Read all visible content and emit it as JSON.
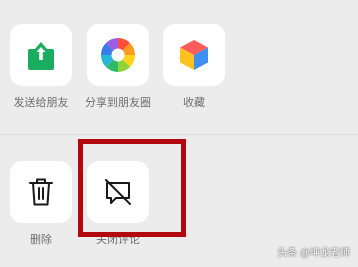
{
  "share_row": [
    {
      "label": "发送给朋友",
      "icon": "send-up-icon"
    },
    {
      "label": "分享到朋友圈",
      "icon": "moments-shutter-icon"
    },
    {
      "label": "收藏",
      "icon": "favorites-cube-icon"
    }
  ],
  "action_row": [
    {
      "label": "删除",
      "icon": "trash-icon"
    },
    {
      "label": "关闭评论",
      "icon": "comment-off-icon"
    }
  ],
  "watermark": "头条 @坤龙老师",
  "colors": {
    "background": "#ececec",
    "tile": "#ffffff",
    "send_green": "#1aad5f",
    "highlight_red": "#b30710",
    "label_gray": "#6e6e6e"
  }
}
